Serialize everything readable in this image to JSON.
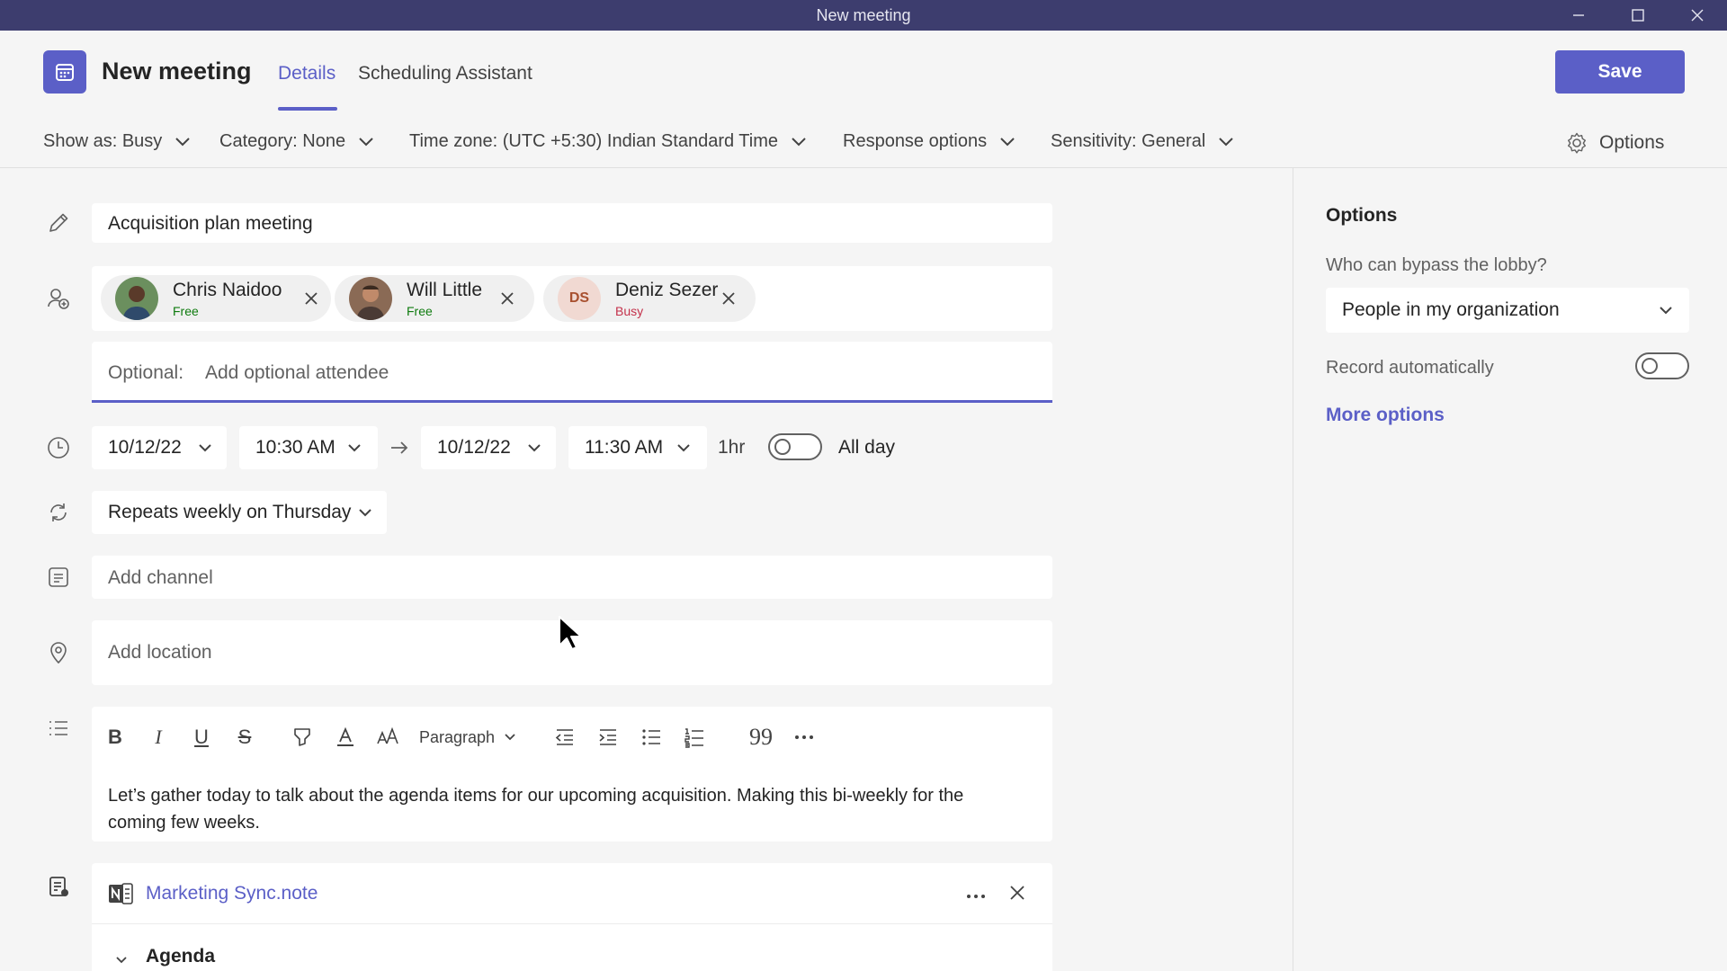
{
  "window": {
    "title": "New meeting",
    "controls": [
      "minimize-icon",
      "maximize-icon",
      "close-icon"
    ]
  },
  "header": {
    "title": "New meeting",
    "tabs": [
      {
        "label": "Details",
        "active": true
      },
      {
        "label": "Scheduling Assistant",
        "active": false
      }
    ],
    "save_label": "Save"
  },
  "toolbar": {
    "show_as": "Show as: Busy",
    "category": "Category: None",
    "time_zone": "Time zone: (UTC +5:30) Indian Standard Time",
    "response_options": "Response options",
    "sensitivity": "Sensitivity: General",
    "options": "Options"
  },
  "form": {
    "title_value": "Acquisition plan meeting",
    "attendees": [
      {
        "name": "Chris Naidoo",
        "status": "Free",
        "initials": ""
      },
      {
        "name": "Will Little",
        "status": "Free",
        "initials": ""
      },
      {
        "name": "Deniz Sezer",
        "status": "Busy",
        "initials": "DS"
      }
    ],
    "optional_label": "Optional:",
    "optional_placeholder": "Add optional attendee",
    "start_date": "10/12/22",
    "start_time": "10:30 AM",
    "end_date": "10/12/22",
    "end_time": "11:30 AM",
    "duration": "1hr",
    "all_day_label": "All day",
    "all_day_on": false,
    "recurrence": "Repeats weekly on Thursday",
    "channel_placeholder": "Add channel",
    "location_placeholder": "Add location"
  },
  "editor": {
    "paragraph_style": "Paragraph",
    "body": "Let’s gather today to talk about the agenda items for our upcoming acquisition. Making this bi-weekly for the coming few weeks."
  },
  "attachment": {
    "file_name": "Marketing Sync.note",
    "section": "Agenda"
  },
  "options_panel": {
    "title": "Options",
    "bypass_label": "Who can bypass the lobby?",
    "bypass_value": "People in my organization",
    "record_label": "Record automatically",
    "record_on": false,
    "more_options": "More options"
  },
  "colors": {
    "accent": "#5b5fc7",
    "titlebar": "#3d3d6e",
    "free": "#0f7b0f",
    "busy": "#c4314b"
  }
}
